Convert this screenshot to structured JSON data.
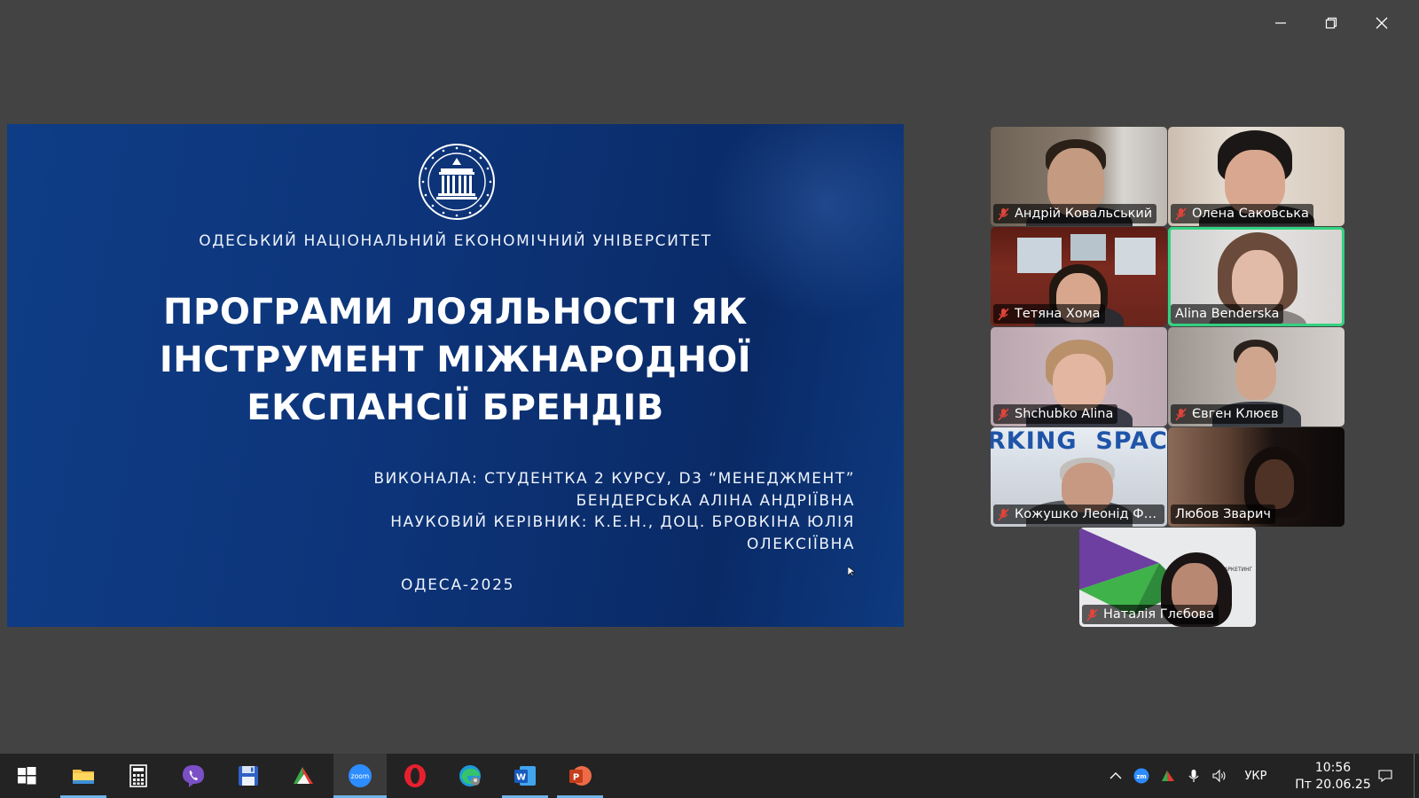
{
  "window": {
    "minimize_icon": "minimize-icon",
    "restore_icon": "restore-icon",
    "close_icon": "close-icon"
  },
  "slide": {
    "university": "ОДЕСЬКИЙ НАЦІОНАЛЬНИЙ ЕКОНОМІЧНИЙ УНІВЕРСИТЕТ",
    "title_lines": [
      "ПРОГРАМИ ЛОЯЛЬНОСТІ ЯК",
      "ІНСТРУМЕНТ МІЖНАРОДНОЇ",
      "ЕКСПАНСІЇ БРЕНДІВ"
    ],
    "author_lines": [
      "ВИКОНАЛА: СТУДЕНТКА 2 КУРСУ, D3 “МЕНЕДЖМЕНТ”",
      "БЕНДЕРСЬКА АЛІНА АНДРІЇВНА",
      "НАУКОВИЙ КЕРІВНИК: К.Е.Н., ДОЦ. БРОВКІНА ЮЛІЯ",
      "ОЛЕКСІЇВНА"
    ],
    "city": "ОДЕСА-2025",
    "seal_text": "ОДЕСЬКИЙ НАЦІОНАЛЬНИЙ ЕКОНОМІЧНИЙ УНІВЕРСИТЕТ · 1921"
  },
  "participants": [
    {
      "name": "Андрій Ковальський",
      "muted": true
    },
    {
      "name": "Олена Саковська",
      "muted": true
    },
    {
      "name": "Тетяна Хома",
      "muted": true
    },
    {
      "name": "Alina Benderska",
      "muted": false,
      "speaking": true
    },
    {
      "name": "Shchubko Alina",
      "muted": true
    },
    {
      "name": "Євген Клюєв",
      "muted": true
    },
    {
      "name": "Кожушко Леонід Фед...",
      "muted": true
    },
    {
      "name": "Любов Зварич",
      "muted": false
    },
    {
      "name": "Наталія Глєбова",
      "muted": true
    }
  ],
  "taskbar": {
    "apps": [
      "start-icon",
      "file-explorer-icon",
      "calculator-icon",
      "viber-icon",
      "save-disk-icon",
      "app-icon",
      "zoom-icon",
      "opera-icon",
      "edge-icon",
      "word-icon",
      "powerpoint-icon"
    ],
    "zoom_label": "zoom",
    "tray_zoom": "zm",
    "language": "УКР",
    "time": "10:56",
    "date": "Пт 20.06.25"
  },
  "colors": {
    "speaking_border": "#31d27f",
    "slide_blue": "#0d3479",
    "muted_mic": "#e0443a"
  }
}
